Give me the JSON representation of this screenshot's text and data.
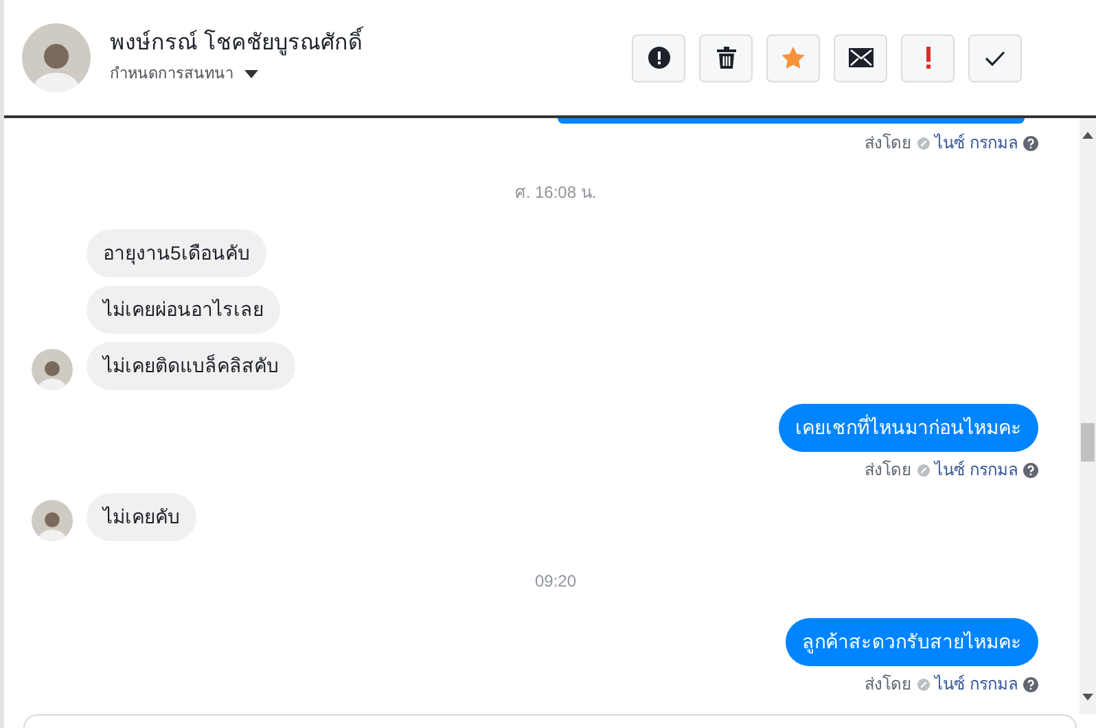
{
  "header": {
    "name": "พงษ์กรณ์ โชคชัยบูรณศักดิ์",
    "subtitle": "กำหนดการสนทนา",
    "actions": [
      {
        "kind": "alert-circle"
      },
      {
        "kind": "trash"
      },
      {
        "kind": "star"
      },
      {
        "kind": "envelope"
      },
      {
        "kind": "exclamation"
      },
      {
        "kind": "check"
      }
    ]
  },
  "messages": [
    {
      "kind": "outgoing_cut",
      "sent_by_label": "ส่งโดย",
      "sender": "ไนซ์ กรกมล"
    },
    {
      "kind": "time",
      "text": "ศ. 16:08 น."
    },
    {
      "kind": "incoming",
      "bubbles": [
        "อายุงาน5เดือนคับ",
        "ไม่เคยผ่อนอาไรเลย",
        "ไม่เคยติดแบล็คลิสคับ"
      ]
    },
    {
      "kind": "outgoing",
      "text": "เคยเชกที่ไหนมาก่อนไหมคะ",
      "sent_by_label": "ส่งโดย",
      "sender": "ไนซ์ กรกมล"
    },
    {
      "kind": "incoming",
      "bubbles": [
        "ไม่เคยคับ"
      ]
    },
    {
      "kind": "time",
      "text": "09:20"
    },
    {
      "kind": "outgoing",
      "text": "ลูกค้าสะดวกรับสายไหมคะ",
      "sent_by_label": "ส่งโดย",
      "sender": "ไนซ์ กรกมล"
    }
  ]
}
